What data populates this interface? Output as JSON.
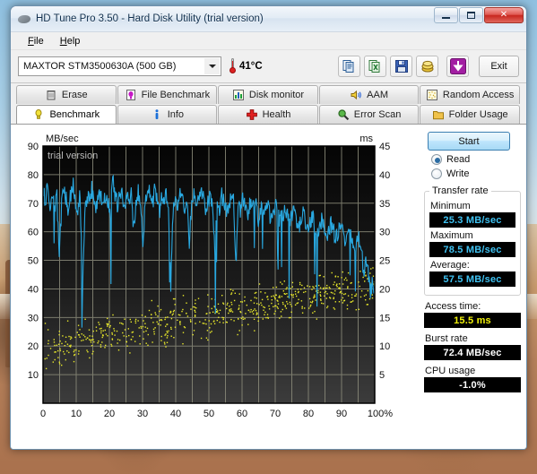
{
  "window": {
    "title": "HD Tune Pro 3.50 - Hard Disk Utility (trial version)",
    "app_icon": "hard-disk-icon",
    "minimize_label": "Minimize",
    "maximize_label": "Maximize",
    "close_label": "✕"
  },
  "menu": [
    {
      "label": "File",
      "accel": "F"
    },
    {
      "label": "Help",
      "accel": "H"
    }
  ],
  "toolbar": {
    "drive_selected": "MAXTOR STM3500630A (500 GB)",
    "drive_options": [
      "MAXTOR STM3500630A (500 GB)"
    ],
    "temperature": "41°C",
    "thermometer_icon": "thermometer-icon",
    "buttons": [
      {
        "name": "copy-to-clipboard-button",
        "icon": "copy-pages-icon"
      },
      {
        "name": "copy-to-excel-button",
        "icon": "copy-excel-icon"
      },
      {
        "name": "save-button",
        "icon": "floppy-disk-icon"
      },
      {
        "name": "options-button",
        "icon": "gold-coins-icon"
      },
      {
        "name": "download-button",
        "icon": "down-arrow-icon"
      }
    ],
    "exit_label": "Exit"
  },
  "tabs": {
    "row1": [
      {
        "label": "Erase",
        "icon": "trash-icon",
        "active": false
      },
      {
        "label": "File Benchmark",
        "icon": "file-bulb-icon",
        "active": false
      },
      {
        "label": "Disk monitor",
        "icon": "bar-chart-icon",
        "active": false
      },
      {
        "label": "AAM",
        "icon": "speaker-icon",
        "active": false
      },
      {
        "label": "Random Access",
        "icon": "dotted-square-icon",
        "active": false
      }
    ],
    "row2": [
      {
        "label": "Benchmark",
        "icon": "yellow-bulb-icon",
        "active": true
      },
      {
        "label": "Info",
        "icon": "info-icon",
        "active": false
      },
      {
        "label": "Health",
        "icon": "red-cross-icon",
        "active": false
      },
      {
        "label": "Error Scan",
        "icon": "magnifier-icon",
        "active": false
      },
      {
        "label": "Folder Usage",
        "icon": "folder-icon",
        "active": false
      }
    ]
  },
  "sidebar": {
    "start_label": "Start",
    "mode_read": "Read",
    "mode_write": "Write",
    "mode_selected": "Read",
    "transfer_group_label": "Transfer rate",
    "minimum_label": "Minimum",
    "minimum_value": "25.3 MB/sec",
    "maximum_label": "Maximum",
    "maximum_value": "78.5 MB/sec",
    "average_label": "Average:",
    "average_value": "57.5 MB/sec",
    "access_time_label": "Access time:",
    "access_time_value": "15.5 ms",
    "burst_rate_label": "Burst rate",
    "burst_rate_value": "72.4 MB/sec",
    "cpu_usage_label": "CPU usage",
    "cpu_usage_value": "-1.0%"
  },
  "colors": {
    "transfer_line": "#29a8e0",
    "access_dots": "#e8e82a",
    "lcd_cyan": "#3fc2f2",
    "lcd_yellow": "#f2f20a",
    "plot_bg_top": "#050505",
    "plot_bg_bottom": "#3a3a3a",
    "grid": "#8b8b7a"
  },
  "chart_data": {
    "type": "line",
    "title": "",
    "watermark": "trial version",
    "ylabel": "MB/sec",
    "y2label": "ms",
    "xlabel": "",
    "xlim": [
      0,
      100
    ],
    "ylim": [
      0,
      90
    ],
    "y2lim": [
      0,
      45
    ],
    "grid": true,
    "x_ticks": [
      "0",
      "10",
      "20",
      "30",
      "40",
      "50",
      "60",
      "70",
      "80",
      "90",
      "100%"
    ],
    "y_ticks": [
      "10",
      "20",
      "30",
      "40",
      "50",
      "60",
      "70",
      "80",
      "90"
    ],
    "y2_ticks": [
      "5",
      "10",
      "15",
      "20",
      "25",
      "30",
      "35",
      "40",
      "45"
    ],
    "series": [
      {
        "name": "Transfer rate",
        "axis": "left",
        "render": "line",
        "color": "#29a8e0",
        "units": "MB/sec",
        "x": [
          0,
          0.7,
          1.4,
          2.1,
          2.8,
          3.5,
          4.2,
          4.9,
          5.6,
          6.3,
          7,
          7.7,
          8.4,
          9.1,
          9.8,
          10.5,
          11.2,
          11.9,
          12.6,
          13.3,
          14,
          14.7,
          15.4,
          16.1,
          16.8,
          17.5,
          18.2,
          18.9,
          19.6,
          20.3,
          21,
          21.7,
          22.4,
          23.1,
          23.8,
          24.5,
          25.2,
          25.9,
          26.6,
          27.3,
          28,
          28.7,
          29.4,
          30.1,
          30.8,
          31.5,
          32.2,
          32.9,
          33.6,
          34.3,
          35,
          35.7,
          36.4,
          37.1,
          37.8,
          38.5,
          39.2,
          39.9,
          40.6,
          41.3,
          42,
          42.7,
          43.4,
          44.1,
          44.8,
          45.5,
          46.2,
          46.9,
          47.6,
          48.3,
          49,
          49.7,
          50.4,
          51.1,
          51.8,
          52.5,
          53.2,
          53.9,
          54.6,
          55.3,
          56,
          56.7,
          57.4,
          58.1,
          58.8,
          59.5,
          60.2,
          60.9,
          61.6,
          62.3,
          63,
          63.7,
          64.4,
          65.1,
          65.8,
          66.5,
          67.2,
          67.9,
          68.6,
          69.3,
          70,
          70.7,
          71.4,
          72.1,
          72.8,
          73.5,
          74.2,
          74.9,
          75.6,
          76.3,
          77,
          77.7,
          78.4,
          79.1,
          79.8,
          80.5,
          81.2,
          81.9,
          82.6,
          83.3,
          84,
          84.7,
          85.4,
          86.1,
          86.8,
          87.5,
          88.2,
          88.9,
          89.6,
          90.3,
          91,
          91.7,
          92.4,
          93.1,
          93.8,
          94.5,
          95.2,
          95.9,
          96.6,
          97.3,
          98,
          98.7,
          99.4,
          100
        ],
        "y": [
          74.5,
          71.8,
          75.2,
          70.4,
          73.6,
          68.2,
          72.0,
          50.2,
          69.5,
          74.8,
          71.2,
          67.6,
          73.2,
          76.0,
          70.8,
          68.4,
          72.6,
          40.5,
          66.2,
          73.8,
          70.2,
          75.4,
          71.6,
          67.8,
          74.2,
          72.4,
          69.0,
          73.0,
          71.0,
          67.2,
          77.8,
          73.4,
          69.8,
          71.4,
          74.6,
          66.8,
          72.2,
          70.0,
          73.6,
          62.0,
          68.8,
          74.0,
          71.2,
          57.5,
          69.4,
          76.2,
          72.8,
          68.0,
          74.4,
          70.6,
          66.4,
          72.0,
          69.2,
          73.8,
          70.4,
          41.0,
          67.6,
          72.4,
          69.8,
          74.2,
          71.0,
          67.4,
          72.8,
          56.0,
          70.2,
          73.4,
          68.6,
          71.8,
          75.2,
          72.0,
          68.4,
          70.8,
          73.0,
          69.6,
          52.4,
          71.4,
          68.0,
          72.6,
          70.2,
          66.8,
          69.4,
          71.0,
          74.6,
          47.6,
          70.0,
          67.2,
          72.2,
          69.0,
          65.4,
          70.6,
          68.2,
          71.4,
          67.8,
          63.0,
          69.2,
          66.4,
          70.0,
          68.6,
          64.2,
          66.8,
          69.8,
          67.0,
          63.6,
          65.4,
          68.2,
          66.0,
          62.8,
          64.6,
          67.4,
          65.0,
          61.2,
          63.8,
          66.2,
          64.0,
          60.4,
          62.6,
          65.0,
          63.2,
          59.6,
          61.8,
          64.2,
          62.0,
          58.4,
          60.6,
          63.0,
          61.0,
          57.2,
          59.4,
          61.8,
          59.8,
          55.0,
          57.6,
          60.2,
          58.4,
          52.8,
          55.6,
          58.0,
          56.2,
          45.0,
          50.4,
          47.2,
          38.5,
          43.0,
          35.8,
          40.2,
          36.0,
          38.0
        ],
        "stats": {
          "minimum": 25.3,
          "maximum": 78.5,
          "average": 57.5
        }
      },
      {
        "name": "Access time",
        "axis": "right",
        "render": "scatter",
        "color": "#e8e82a",
        "units": "ms",
        "mean_ms": 15.5,
        "trend": "rises from about 10 ms at 0% to about 21 ms at 100%",
        "spread_ms": 5.5
      }
    ]
  }
}
